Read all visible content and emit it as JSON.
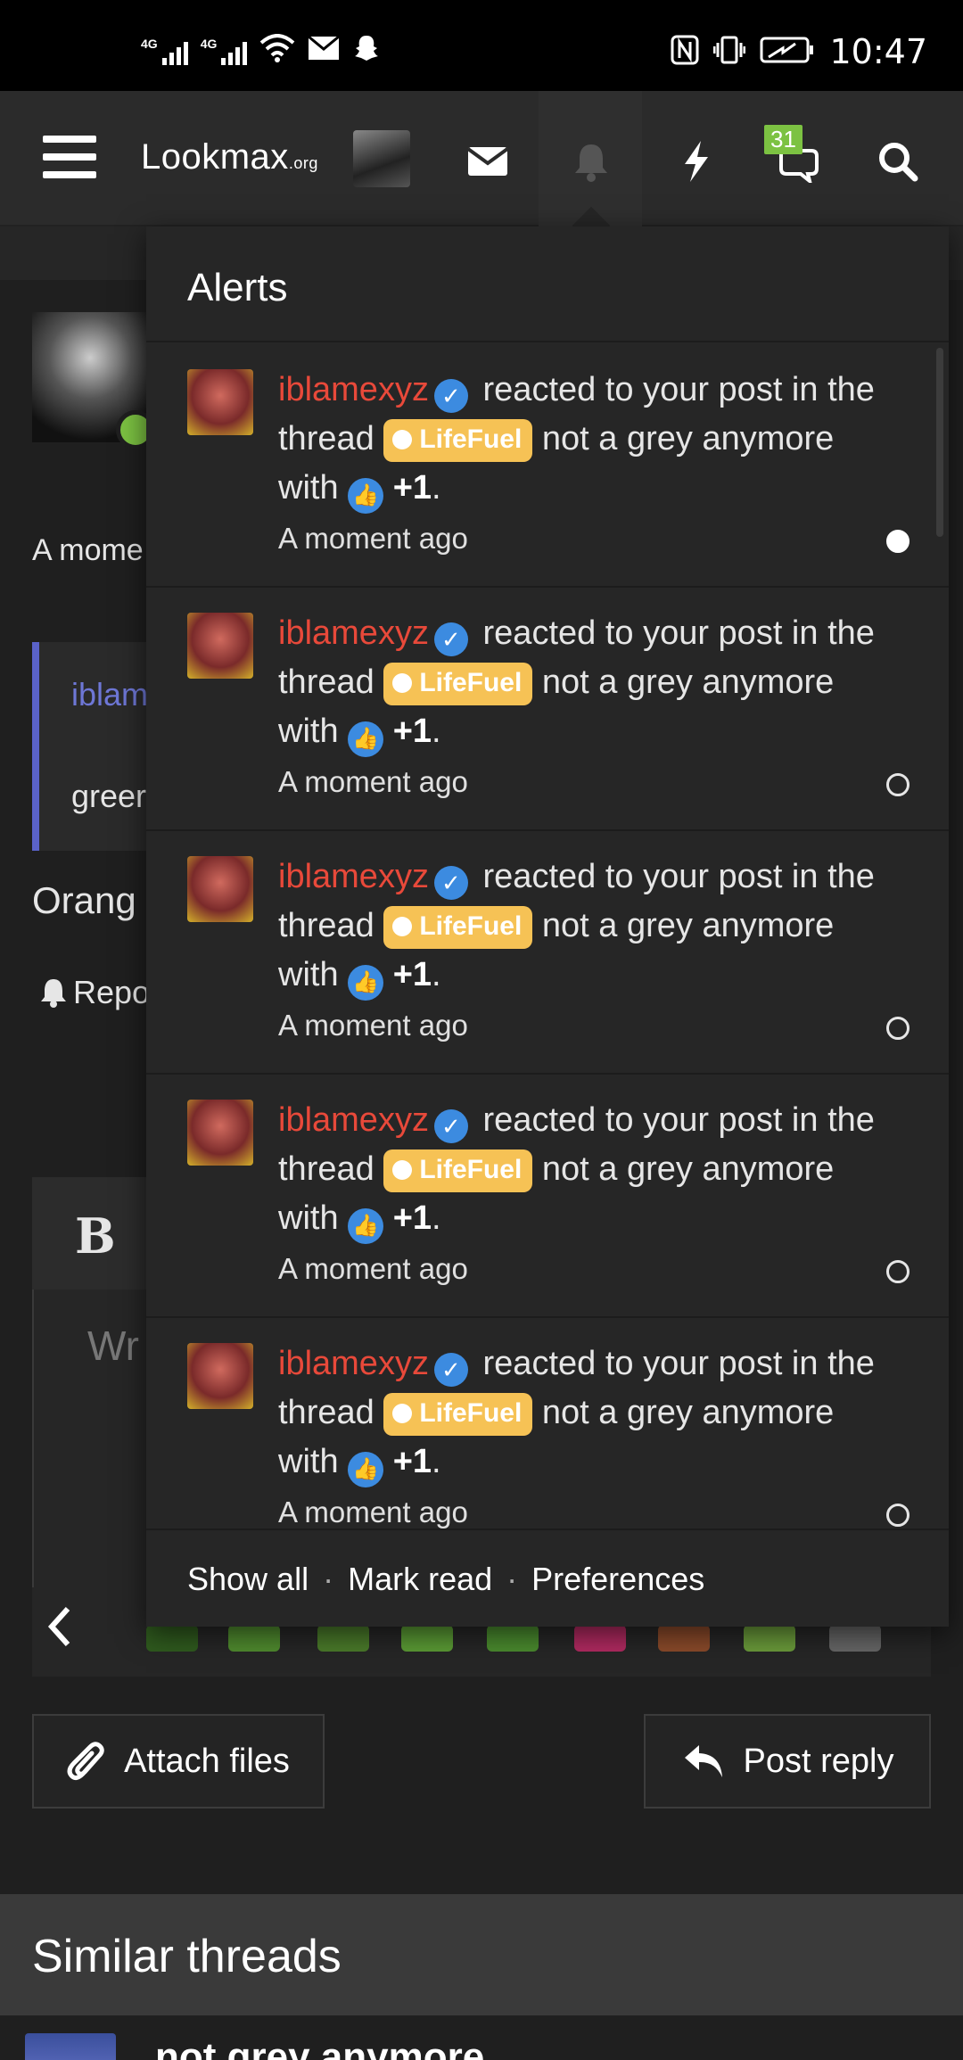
{
  "status_bar": {
    "network_1": "4G",
    "network_2": "4G",
    "time": "10:47"
  },
  "header": {
    "logo_text": "Lookmax",
    "logo_suffix": ".org",
    "conversations_badge": "31"
  },
  "background_page": {
    "post_time_partial": "A mome",
    "quote_user_partial": "iblam",
    "quote_text_partial": "greer",
    "post_text_partial": "Orang",
    "report_partial": "Repo",
    "editor_bold": "B",
    "editor_placeholder_partial": "Wr",
    "attach_files_label": "Attach files",
    "post_reply_label": "Post reply",
    "similar_threads_title": "Similar threads",
    "similar_thread_title_partial": "not grey anymore"
  },
  "alerts": {
    "title": "Alerts",
    "items": [
      {
        "user": "iblamexyz",
        "action": "reacted to your post in the thread",
        "prefix": "LifeFuel",
        "thread": "not a grey anymore",
        "with": "with",
        "reaction": "+1",
        "time": "A moment ago",
        "read": false
      },
      {
        "user": "iblamexyz",
        "action": "reacted to your post in the thread",
        "prefix": "LifeFuel",
        "thread": "not a grey anymore",
        "with": "with",
        "reaction": "+1",
        "time": "A moment ago",
        "read": true
      },
      {
        "user": "iblamexyz",
        "action": "reacted to your post in the thread",
        "prefix": "LifeFuel",
        "thread": "not a grey anymore",
        "with": "with",
        "reaction": "+1",
        "time": "A moment ago",
        "read": true
      },
      {
        "user": "iblamexyz",
        "action": "reacted to your post in the thread",
        "prefix": "LifeFuel",
        "thread": "not a grey anymore",
        "with": "with",
        "reaction": "+1",
        "time": "A moment ago",
        "read": true
      },
      {
        "user": "iblamexyz",
        "action": "reacted to your post in the thread",
        "prefix": "LifeFuel",
        "thread": "not a grey anymore",
        "with": "with",
        "reaction": "+1",
        "time": "A moment ago",
        "read": true
      }
    ],
    "footer": {
      "show_all": "Show all",
      "mark_read": "Mark read",
      "preferences": "Preferences",
      "separator": "·"
    }
  },
  "colors": {
    "username": "#e8493a",
    "prefix_bg": "#f6c255",
    "badge_bg": "#7cc242",
    "verified": "#3c8be0"
  }
}
